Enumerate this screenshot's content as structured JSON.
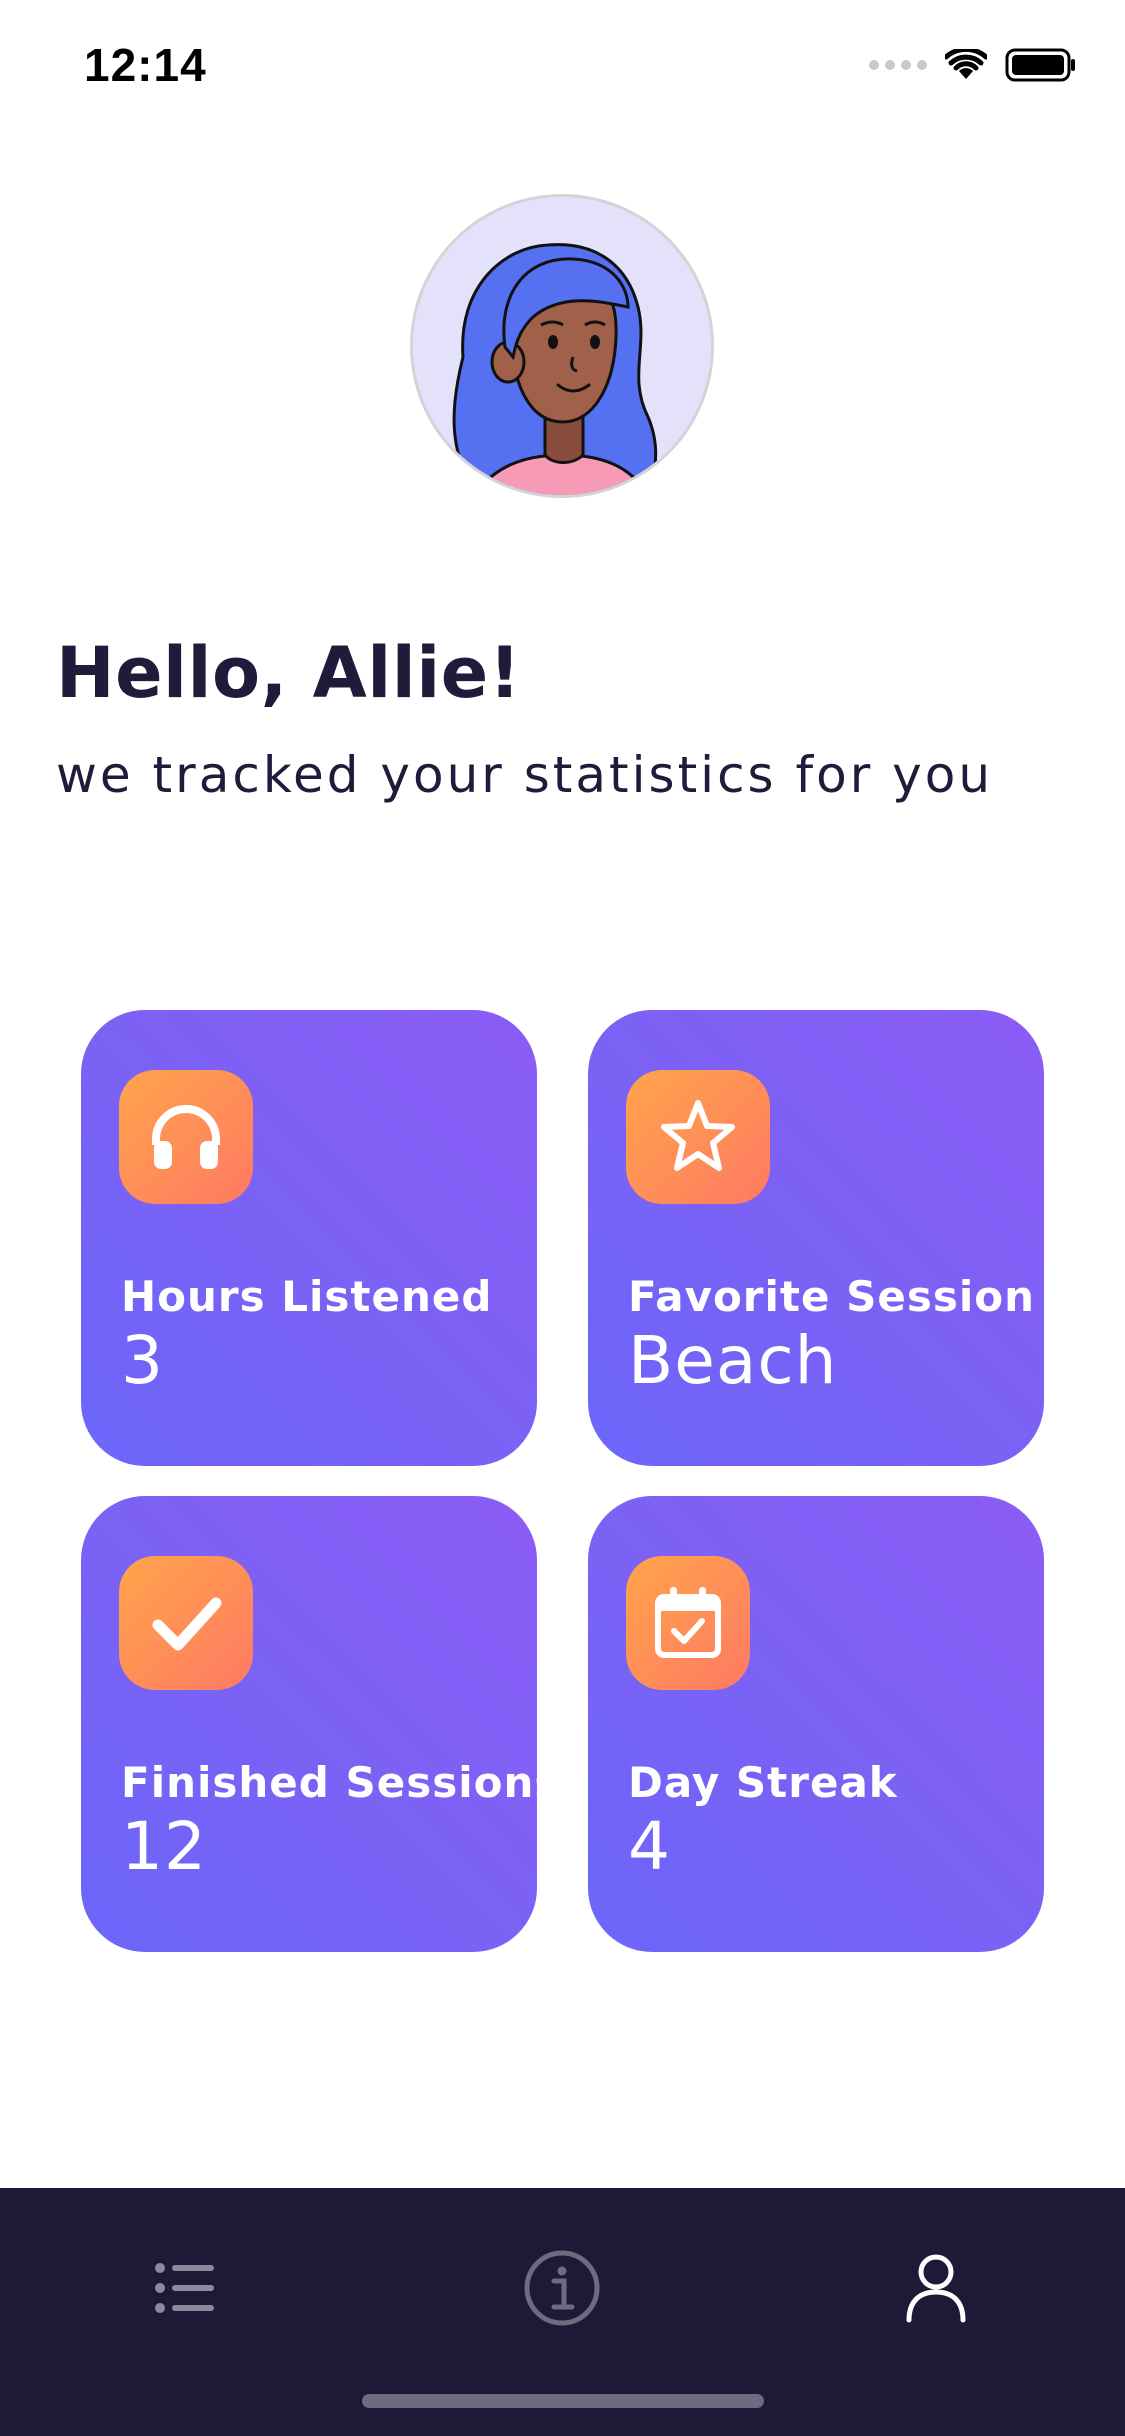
{
  "status_bar": {
    "time": "12:14"
  },
  "profile": {
    "greeting": "Hello, Allie!",
    "subtitle": "we tracked your statistics for you"
  },
  "stats": [
    {
      "label": "Hours Listened",
      "value": "3",
      "icon": "headphones-icon"
    },
    {
      "label": "Favorite Session",
      "value": "Beach",
      "icon": "star-icon"
    },
    {
      "label": "Finished Sessions",
      "value": "12",
      "icon": "checkmark-icon"
    },
    {
      "label": "Day Streak",
      "value": "4",
      "icon": "calendar-check-icon"
    }
  ],
  "tab_bar": {
    "items": [
      {
        "icon": "list-icon",
        "active": false
      },
      {
        "icon": "info-icon",
        "active": false
      },
      {
        "icon": "profile-icon",
        "active": true
      }
    ]
  },
  "colors": {
    "card_gradient_start": "#8b5cf6",
    "card_gradient_end": "#6b66fa",
    "icon_gradient_start": "#ffa44a",
    "icon_gradient_end": "#ff7a64",
    "text_dark": "#1f1b3a",
    "tab_bar_bg": "#1d1a37"
  }
}
